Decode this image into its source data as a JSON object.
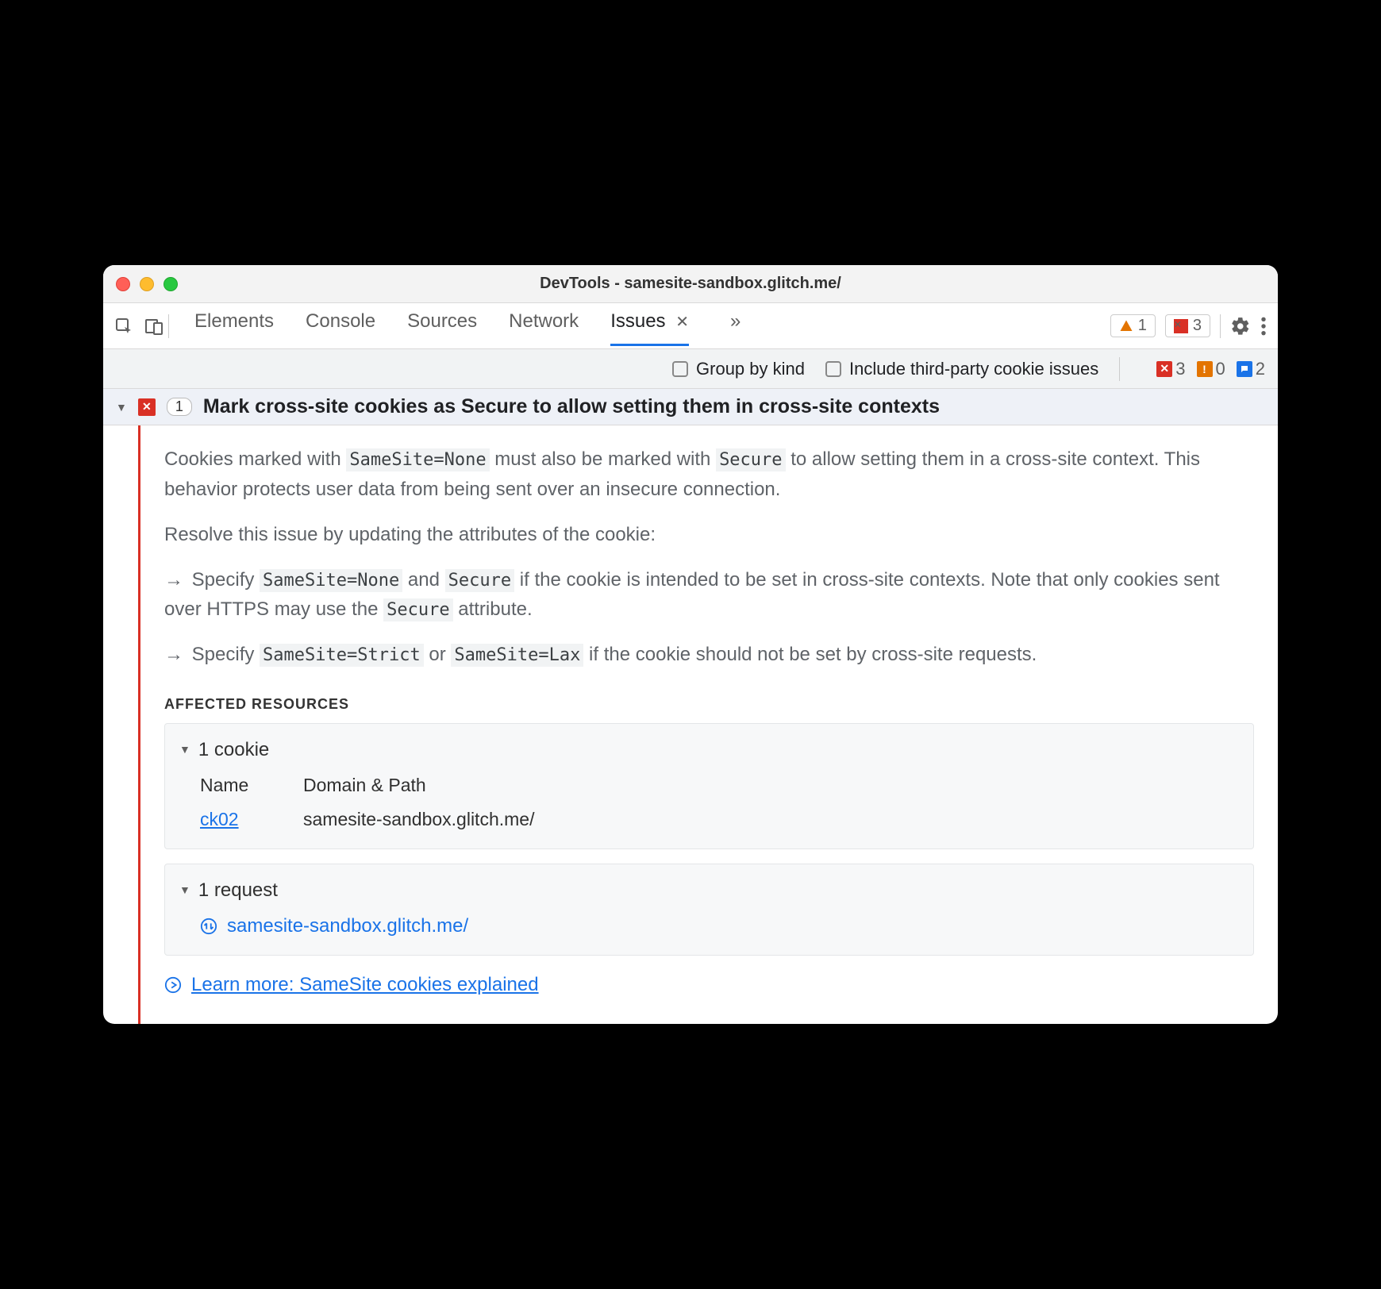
{
  "window_title": "DevTools - samesite-sandbox.glitch.me/",
  "tabs": {
    "elements": "Elements",
    "console": "Console",
    "sources": "Sources",
    "network": "Network",
    "issues": "Issues"
  },
  "tab_badges": {
    "warning_count": "1",
    "error_count": "3"
  },
  "filterbar": {
    "group_by_kind": "Group by kind",
    "include_3p": "Include third-party cookie issues",
    "badge_error": "3",
    "badge_warn": "0",
    "badge_info": "2"
  },
  "issue": {
    "count": "1",
    "title": "Mark cross-site cookies as Secure to allow setting them in cross-site contexts",
    "p1_a": "Cookies marked with ",
    "p1_code1": "SameSite=None",
    "p1_b": " must also be marked with ",
    "p1_code2": "Secure",
    "p1_c": " to allow setting them in a cross-site context. This behavior protects user data from being sent over an insecure connection.",
    "p2": "Resolve this issue by updating the attributes of the cookie:",
    "b1_a": "Specify ",
    "b1_code1": "SameSite=None",
    "b1_b": " and ",
    "b1_code2": "Secure",
    "b1_c": " if the cookie is intended to be set in cross-site contexts. Note that only cookies sent over HTTPS may use the ",
    "b1_code3": "Secure",
    "b1_d": " attribute.",
    "b2_a": "Specify ",
    "b2_code1": "SameSite=Strict",
    "b2_b": " or ",
    "b2_code2": "SameSite=Lax",
    "b2_c": " if the cookie should not be set by cross-site requests.",
    "affected_label": "AFFECTED RESOURCES",
    "cookie_header": "1 cookie",
    "col_name": "Name",
    "col_domain": "Domain & Path",
    "cookie_name": "ck02",
    "cookie_domain": "samesite-sandbox.glitch.me/",
    "request_header": "1 request",
    "request_url": "samesite-sandbox.glitch.me/",
    "learn_more": "Learn more: SameSite cookies explained"
  }
}
